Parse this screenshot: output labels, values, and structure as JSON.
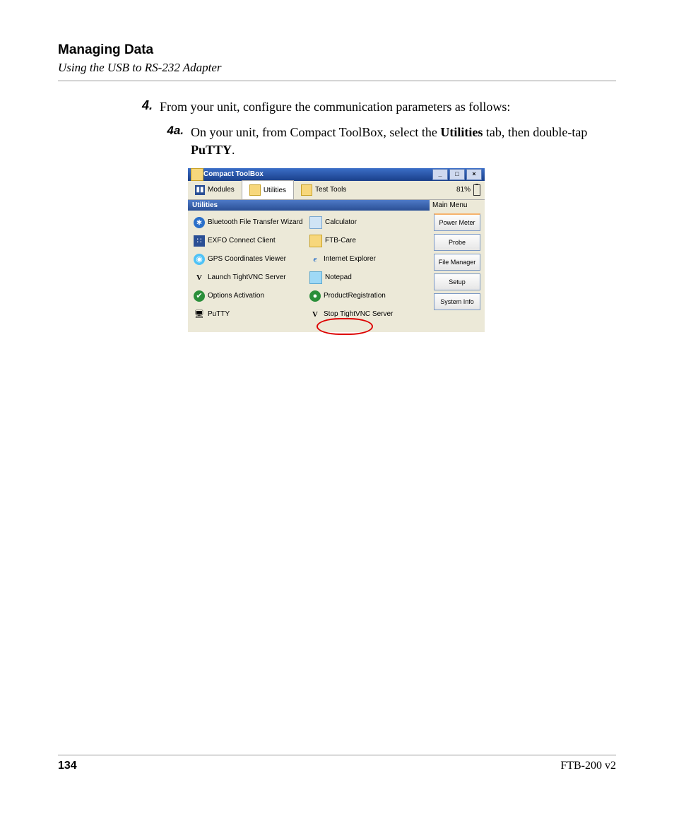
{
  "header": {
    "title": "Managing Data",
    "subtitle": "Using the USB to RS-232 Adapter"
  },
  "step": {
    "num": "4.",
    "text_a": "From your unit, configure the communication parameters as follows:"
  },
  "substep": {
    "num": "4a.",
    "pre": "On your unit, from Compact ToolBox, select the ",
    "bold1": "Utilities",
    "mid": " tab, then double-tap ",
    "bold2": "PuTTY",
    "post": "."
  },
  "shot": {
    "title": "Compact ToolBox",
    "win_min": "_",
    "win_max": "□",
    "win_close": "×",
    "tabs": {
      "modules": "Modules",
      "utilities": "Utilities",
      "testtools": "Test Tools"
    },
    "battery": "81%",
    "panel_label": "Utilities",
    "items_left": [
      "Bluetooth File Transfer Wizard",
      "EXFO Connect Client",
      "GPS Coordinates Viewer",
      "Launch TightVNC Server",
      "Options Activation",
      "PuTTY"
    ],
    "items_right": [
      "Calculator",
      "FTB-Care",
      "Internet Explorer",
      "Notepad",
      "ProductRegistration",
      "Stop TightVNC Server"
    ],
    "menu_head": "Main Menu",
    "menu": [
      "Power Meter",
      "Probe",
      "File Manager",
      "Setup",
      "System Info"
    ]
  },
  "footer": {
    "page": "134",
    "doc": "FTB-200 v2"
  }
}
